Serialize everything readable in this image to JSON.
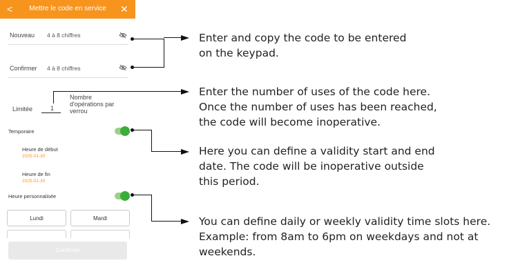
{
  "header": {
    "back": "<",
    "title": "Mettre le code en service",
    "close": "✕"
  },
  "form": {
    "nouveau_label": "Nouveau",
    "nouveau_placeholder": "4 à 8 chiffres",
    "confirmer_label": "Confirmer",
    "confirmer_placeholder": "4 à 8 chiffres",
    "limitee_label": "Limitée",
    "limitee_value": "1",
    "limitee_desc_1": "Nombre",
    "limitee_desc_2": "d'opérations par",
    "limitee_desc_3": "verrou",
    "temporaire_label": "Temporaire",
    "start_label": "Heure de début",
    "start_date": "2025-01-30",
    "end_label": "Heure de fin",
    "end_date": "2025-01-30",
    "custom_time_label": "Heure personnalisée",
    "days": [
      "Lundi",
      "Mardi"
    ],
    "confirm_button": "Confirmer"
  },
  "annotations": {
    "code": [
      "Enter and copy the code to be entered",
      "on the keypad."
    ],
    "uses": [
      "Enter the number of uses of the code here.",
      "Once the number of uses has been reached,",
      "the code will become inoperative."
    ],
    "validity": [
      "Here you can define a validity start and end",
      "date. The code will be inoperative outside",
      "this period."
    ],
    "slots": [
      "You can define daily or weekly validity time slots here.",
      "Example: from 8am to 6pm on weekdays and not at",
      "weekends."
    ]
  },
  "colors": {
    "accent": "#f7941d",
    "toggle_on": "#3aae3a"
  },
  "icons": {
    "back": "chevron-left-icon",
    "close": "close-icon",
    "visibility": "eye-off-icon"
  }
}
